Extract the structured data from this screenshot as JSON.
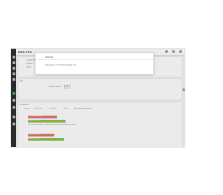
{
  "app": {
    "logo": "RMS.PRO"
  },
  "modal": {
    "title": "PAYDAY",
    "message": "Data saved, do not close the page. (3)"
  },
  "panels": {
    "top": {
      "lines": [
        "Cust ID 001",
        "Payment",
        "Status"
      ]
    },
    "filter": {
      "title": "Filter",
      "label": "Payment period",
      "value": "All"
    },
    "table": {
      "title": "Transactions",
      "tabs": [
        "Summary",
        "Cash transfer",
        "E-transfer",
        "Cheque",
        "Direct deposit transactions"
      ],
      "rows": [
        {
          "tag": "Processed transaction",
          "tag2": "Deposit recorded",
          "note": "The transaction has been completed successfully and recorded in the system."
        },
        {
          "tag": "Pending transaction",
          "tag2": "Deposit scheduled",
          "note": ""
        }
      ]
    }
  },
  "colors": {
    "sidebar": "#2f2f2f",
    "accent": "#4caf50",
    "tag_red": "#e57373",
    "tag_green": "#8bc34a"
  },
  "icons": [
    "home-icon",
    "user-icon",
    "dollar-icon",
    "chart-icon",
    "file-icon",
    "settings-icon",
    "calendar-icon",
    "mail-icon",
    "bell-icon",
    "help-icon"
  ]
}
